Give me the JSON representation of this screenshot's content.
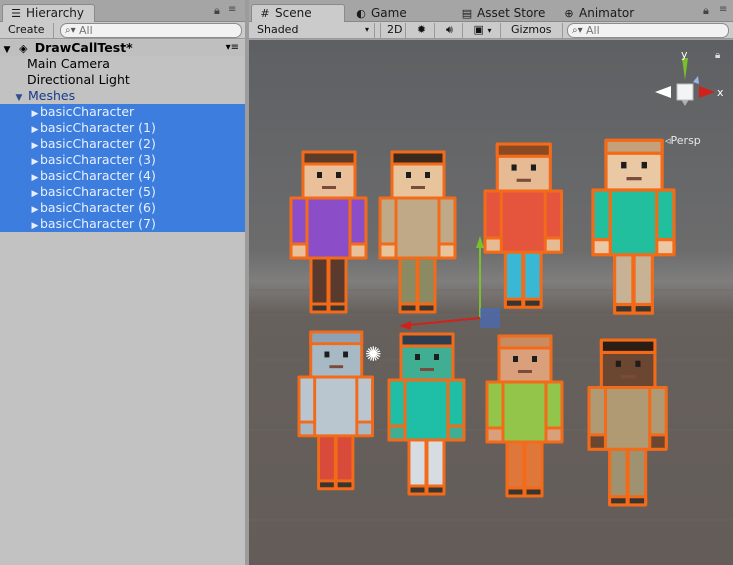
{
  "hierarchy": {
    "tab_label": "Hierarchy",
    "create_label": "Create",
    "search_placeholder": "All",
    "scene_name": "DrawCallTest*",
    "items": [
      {
        "label": "Main Camera"
      },
      {
        "label": "Directional Light"
      },
      {
        "label": "Meshes"
      }
    ],
    "children": [
      {
        "label": "basicCharacter"
      },
      {
        "label": "basicCharacter (1)"
      },
      {
        "label": "basicCharacter (2)"
      },
      {
        "label": "basicCharacter (3)"
      },
      {
        "label": "basicCharacter (4)"
      },
      {
        "label": "basicCharacter (5)"
      },
      {
        "label": "basicCharacter (6)"
      },
      {
        "label": "basicCharacter (7)"
      }
    ]
  },
  "tabs": {
    "scene": "Scene",
    "game": "Game",
    "asset_store": "Asset Store",
    "animator": "Animator"
  },
  "scene_toolbar": {
    "shading": "Shaded",
    "mode_2d": "2D",
    "gizmos": "Gizmos",
    "search_placeholder": "All"
  },
  "gizmo": {
    "y_label": "y",
    "x_label": "x",
    "projection": "Persp"
  },
  "colors": {
    "selection": "#3c7dde",
    "outline": "#f36a19",
    "axis_x": "#d0221b",
    "axis_y": "#79c02b",
    "axis_z": "#3f6dd6"
  },
  "characters": [
    {
      "shirt": "#8c4dc9",
      "pants": "#5a3a2c",
      "skin": "#e9c09a",
      "hair": "#5c3b28"
    },
    {
      "shirt": "#bfa987",
      "pants": "#8a8a63",
      "skin": "#e8c49d",
      "hair": "#3a2a1d"
    },
    {
      "shirt": "#e5553e",
      "pants": "#39b8d6",
      "skin": "#e6bb93",
      "hair": "#8a4a24"
    },
    {
      "shirt": "#21bf9e",
      "pants": "#c8b295",
      "skin": "#eac8a4",
      "hair": "#c4a17a"
    },
    {
      "shirt": "#b9c5cf",
      "pants": "#d84a3a",
      "skin": "#a8b9c6",
      "hair": "#8ea2b3"
    },
    {
      "shirt": "#1ebfa6",
      "pants": "#d5dde2",
      "skin": "#3fae93",
      "hair": "#2f3d4e"
    },
    {
      "shirt": "#92c54a",
      "pants": "#e0773a",
      "skin": "#d9a07b",
      "hair": "#c98c62"
    },
    {
      "shirt": "#b09a74",
      "pants": "#9f9270",
      "skin": "#6b4731",
      "hair": "#2a1d16"
    }
  ]
}
